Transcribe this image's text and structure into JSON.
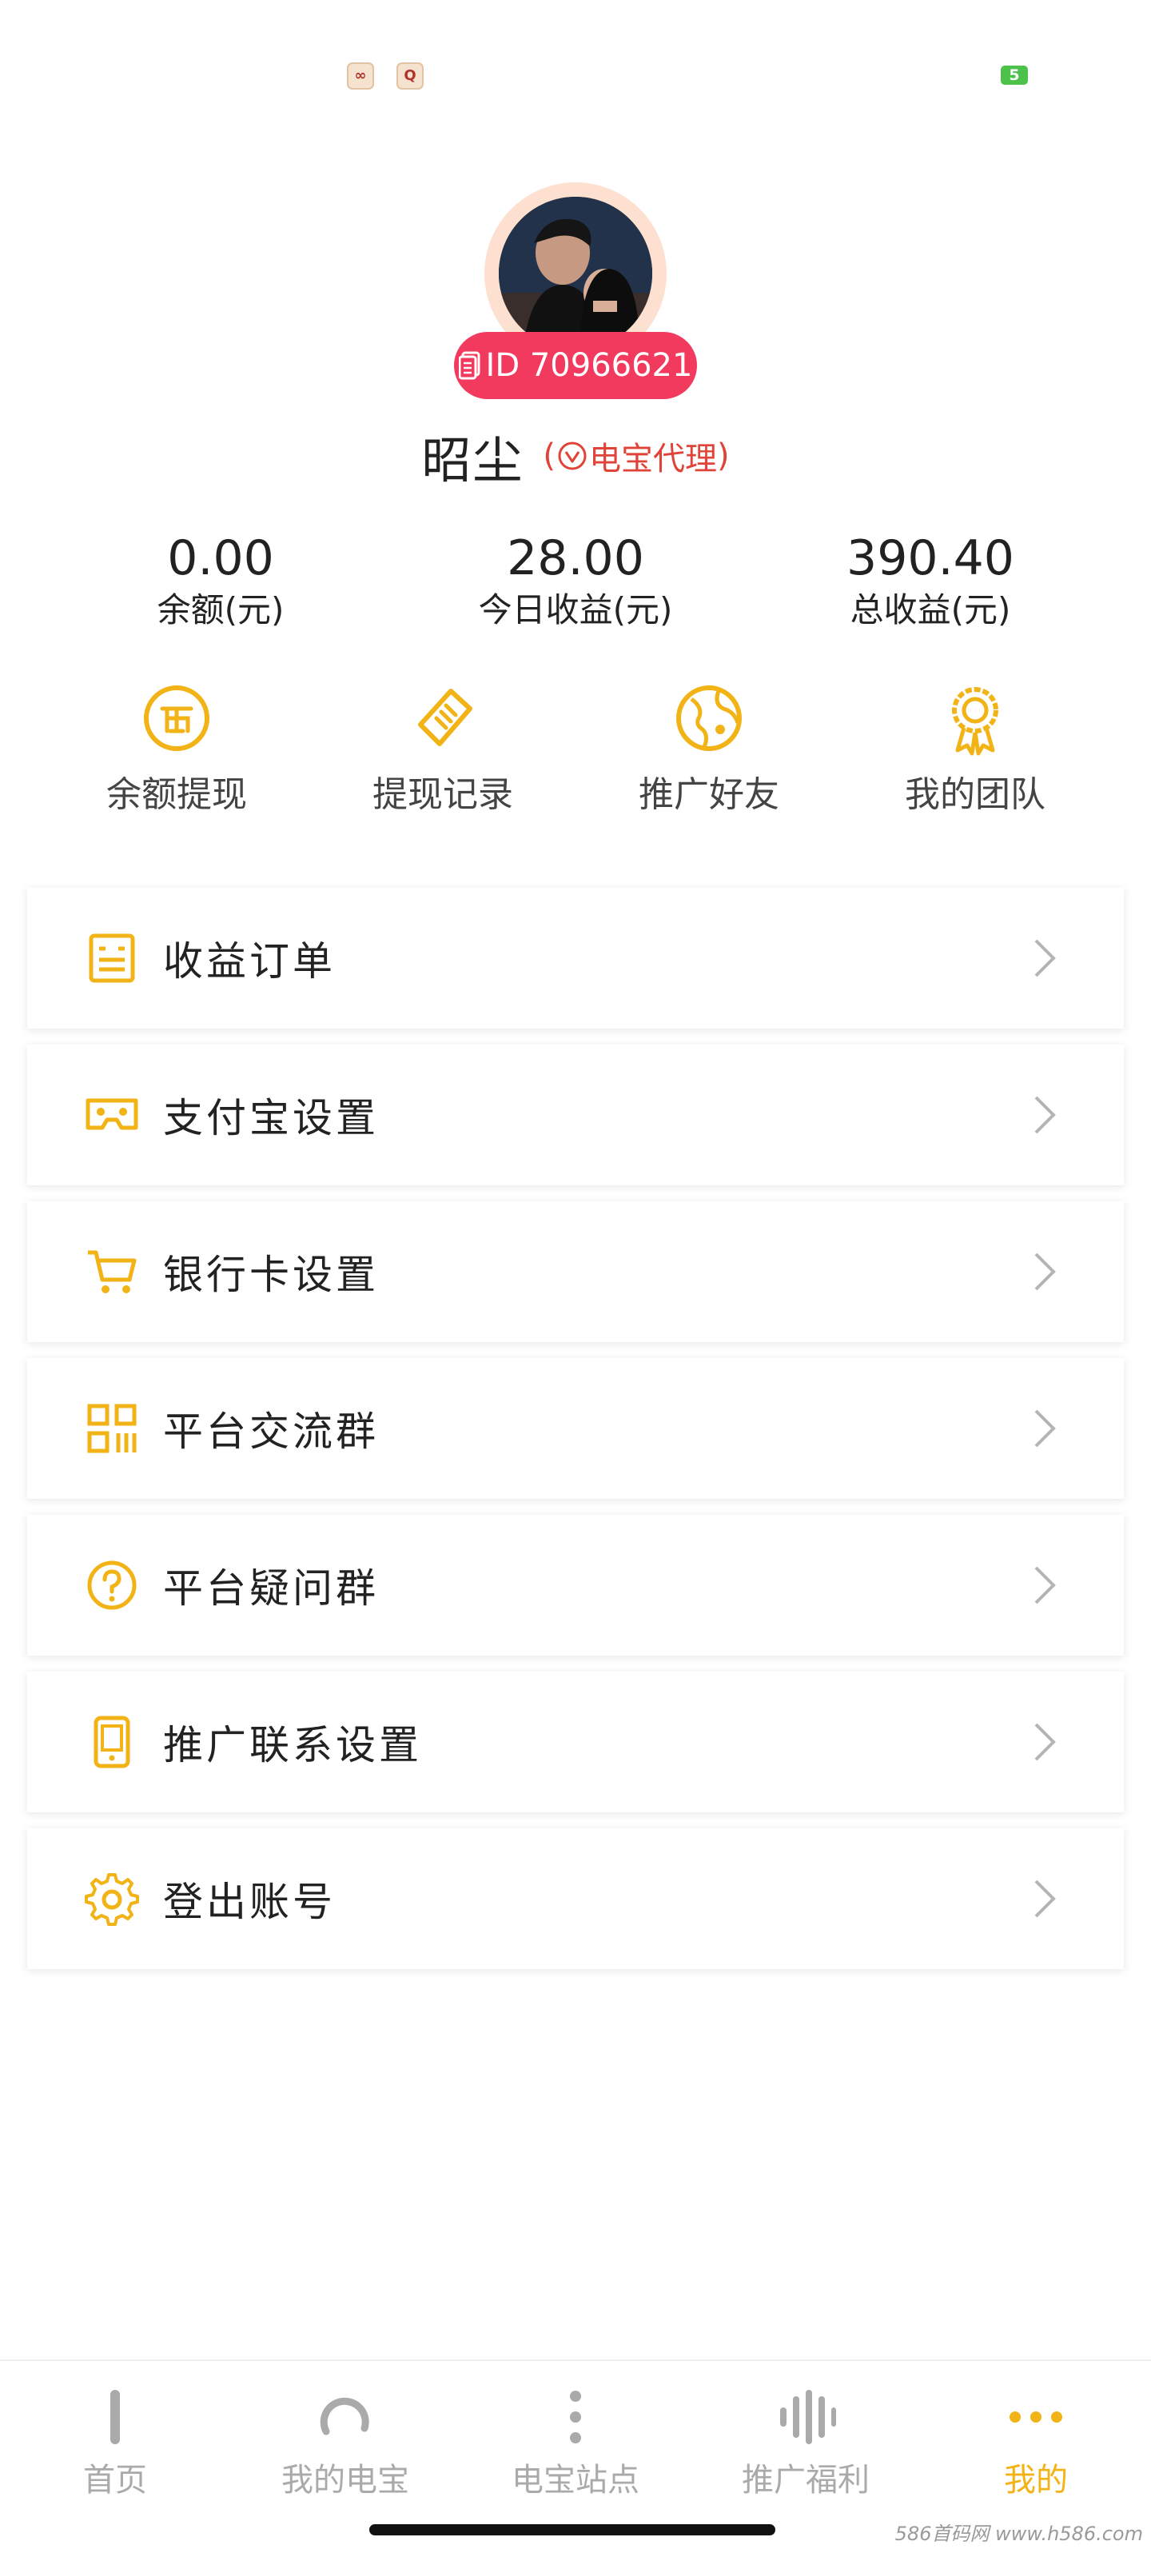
{
  "status_bar": {
    "battery": "5"
  },
  "profile": {
    "id_text": "ID 70966621",
    "name": "昭尘",
    "tag_open": "(",
    "tag_text": "电宝代理",
    "tag_close": ")"
  },
  "stats": [
    {
      "value": "0.00",
      "label": "余额(元)"
    },
    {
      "value": "28.00",
      "label": "今日收益(元)"
    },
    {
      "value": "390.40",
      "label": "总收益(元)"
    }
  ],
  "actions": [
    {
      "label": "余额提现",
      "icon": "coin-icon"
    },
    {
      "label": "提现记录",
      "icon": "ticket-icon"
    },
    {
      "label": "推广好友",
      "icon": "globe-icon"
    },
    {
      "label": "我的团队",
      "icon": "badge-icon"
    }
  ],
  "menu": [
    {
      "label": "收益订单",
      "icon": "order-list-icon"
    },
    {
      "label": "支付宝设置",
      "icon": "wallet-icon"
    },
    {
      "label": "银行卡设置",
      "icon": "cart-icon"
    },
    {
      "label": "平台交流群",
      "icon": "qrcode-icon"
    },
    {
      "label": "平台疑问群",
      "icon": "question-icon"
    },
    {
      "label": "推广联系设置",
      "icon": "phone-icon"
    },
    {
      "label": "登出账号",
      "icon": "gear-icon"
    }
  ],
  "nav": [
    {
      "label": "首页",
      "icon": "home-bar-icon"
    },
    {
      "label": "我的电宝",
      "icon": "loading-arc-icon"
    },
    {
      "label": "电宝站点",
      "icon": "vertical-dots-icon"
    },
    {
      "label": "推广福利",
      "icon": "bars-icon"
    },
    {
      "label": "我的",
      "icon": "horizontal-dots-icon",
      "active": true
    }
  ],
  "watermark": "586首码网 www.h586.com",
  "colors": {
    "accent": "#f2b316",
    "id_badge": "#f23a5e",
    "agent_tag": "#e04438",
    "nav_inactive": "#aaaaaa"
  }
}
